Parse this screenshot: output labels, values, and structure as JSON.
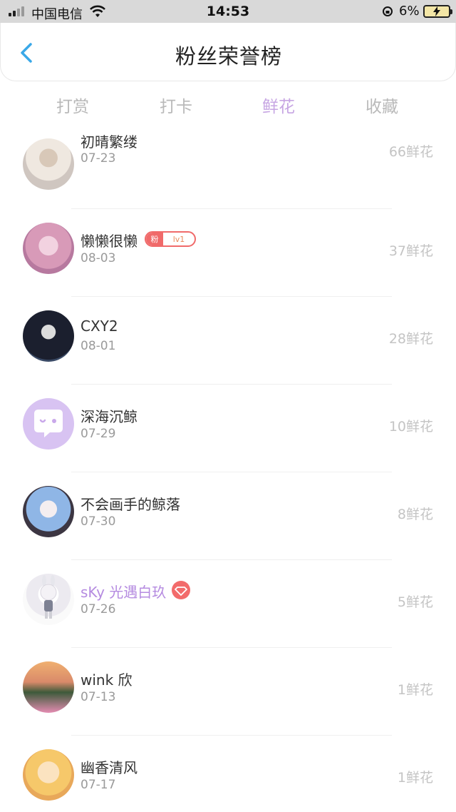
{
  "status_bar": {
    "carrier": "中国电信",
    "time": "14:53",
    "battery": "6%"
  },
  "header": {
    "title": "粉丝荣誉榜"
  },
  "tabs": [
    {
      "label": "打赏",
      "active": false
    },
    {
      "label": "打卡",
      "active": false
    },
    {
      "label": "鲜花",
      "active": true
    },
    {
      "label": "收藏",
      "active": false
    }
  ],
  "fans": [
    {
      "name": "初晴繁缕",
      "date": "07-23",
      "count": "66鲜花"
    },
    {
      "name": "懒懒很懒",
      "date": "08-03",
      "count": "37鲜花",
      "badge": {
        "left": "粉",
        "right": "lv1"
      }
    },
    {
      "name": "CXY2",
      "date": "08-01",
      "count": "28鲜花"
    },
    {
      "name": "深海沉鲸",
      "date": "07-29",
      "count": "10鲜花"
    },
    {
      "name": "不会画手的鲸落",
      "date": "07-30",
      "count": "8鲜花"
    },
    {
      "name": "sKy 光遇白玖",
      "date": "07-26",
      "count": "5鲜花"
    },
    {
      "name": "wink 欣",
      "date": "07-13",
      "count": "1鲜花"
    },
    {
      "name": "幽香清风",
      "date": "07-17",
      "count": "1鲜花"
    }
  ],
  "colors": {
    "accent": "#c7a6e3",
    "vip_name": "#b58be0",
    "badge_red": "#f06a6a"
  }
}
